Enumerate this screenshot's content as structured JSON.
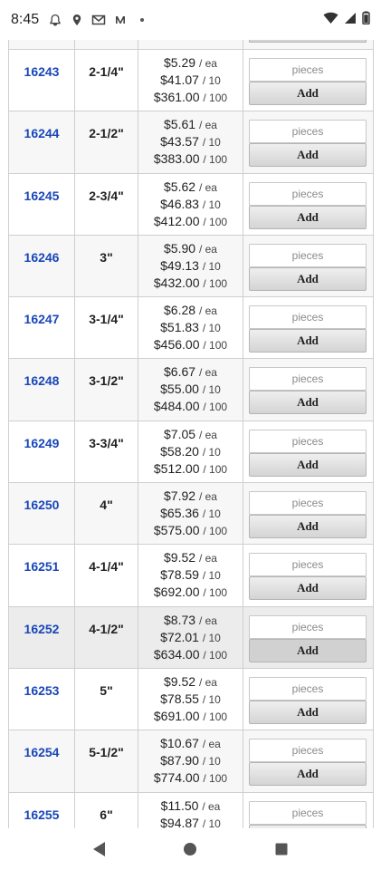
{
  "status_bar": {
    "time": "8:45",
    "left_icons": [
      "notification-bell-icon",
      "location-pin-icon",
      "gmail-icon",
      "medium-icon",
      "dot-icon"
    ],
    "right_icons": [
      "wifi-icon",
      "cell-signal-icon",
      "battery-icon"
    ]
  },
  "table": {
    "rows": [
      {
        "number": "16243",
        "size": "2-1/4\"",
        "prices": [
          {
            "amount": "$5.29",
            "unit": "/ ea"
          },
          {
            "amount": "$41.07",
            "unit": "/ 10"
          },
          {
            "amount": "$361.00",
            "unit": "/ 100"
          }
        ],
        "placeholder": "pieces",
        "button": "Add"
      },
      {
        "number": "16244",
        "size": "2-1/2\"",
        "prices": [
          {
            "amount": "$5.61",
            "unit": "/ ea"
          },
          {
            "amount": "$43.57",
            "unit": "/ 10"
          },
          {
            "amount": "$383.00",
            "unit": "/ 100"
          }
        ],
        "placeholder": "pieces",
        "button": "Add"
      },
      {
        "number": "16245",
        "size": "2-3/4\"",
        "prices": [
          {
            "amount": "$5.62",
            "unit": "/ ea"
          },
          {
            "amount": "$46.83",
            "unit": "/ 10"
          },
          {
            "amount": "$412.00",
            "unit": "/ 100"
          }
        ],
        "placeholder": "pieces",
        "button": "Add"
      },
      {
        "number": "16246",
        "size": "3\"",
        "prices": [
          {
            "amount": "$5.90",
            "unit": "/ ea"
          },
          {
            "amount": "$49.13",
            "unit": "/ 10"
          },
          {
            "amount": "$432.00",
            "unit": "/ 100"
          }
        ],
        "placeholder": "pieces",
        "button": "Add"
      },
      {
        "number": "16247",
        "size": "3-1/4\"",
        "prices": [
          {
            "amount": "$6.28",
            "unit": "/ ea"
          },
          {
            "amount": "$51.83",
            "unit": "/ 10"
          },
          {
            "amount": "$456.00",
            "unit": "/ 100"
          }
        ],
        "placeholder": "pieces",
        "button": "Add"
      },
      {
        "number": "16248",
        "size": "3-1/2\"",
        "prices": [
          {
            "amount": "$6.67",
            "unit": "/ ea"
          },
          {
            "amount": "$55.00",
            "unit": "/ 10"
          },
          {
            "amount": "$484.00",
            "unit": "/ 100"
          }
        ],
        "placeholder": "pieces",
        "button": "Add"
      },
      {
        "number": "16249",
        "size": "3-3/4\"",
        "prices": [
          {
            "amount": "$7.05",
            "unit": "/ ea"
          },
          {
            "amount": "$58.20",
            "unit": "/ 10"
          },
          {
            "amount": "$512.00",
            "unit": "/ 100"
          }
        ],
        "placeholder": "pieces",
        "button": "Add"
      },
      {
        "number": "16250",
        "size": "4\"",
        "prices": [
          {
            "amount": "$7.92",
            "unit": "/ ea"
          },
          {
            "amount": "$65.36",
            "unit": "/ 10"
          },
          {
            "amount": "$575.00",
            "unit": "/ 100"
          }
        ],
        "placeholder": "pieces",
        "button": "Add"
      },
      {
        "number": "16251",
        "size": "4-1/4\"",
        "prices": [
          {
            "amount": "$9.52",
            "unit": "/ ea"
          },
          {
            "amount": "$78.59",
            "unit": "/ 10"
          },
          {
            "amount": "$692.00",
            "unit": "/ 100"
          }
        ],
        "placeholder": "pieces",
        "button": "Add"
      },
      {
        "number": "16252",
        "size": "4-1/2\"",
        "prices": [
          {
            "amount": "$8.73",
            "unit": "/ ea"
          },
          {
            "amount": "$72.01",
            "unit": "/ 10"
          },
          {
            "amount": "$634.00",
            "unit": "/ 100"
          }
        ],
        "placeholder": "pieces",
        "button": "Add"
      },
      {
        "number": "16253",
        "size": "5\"",
        "prices": [
          {
            "amount": "$9.52",
            "unit": "/ ea"
          },
          {
            "amount": "$78.55",
            "unit": "/ 10"
          },
          {
            "amount": "$691.00",
            "unit": "/ 100"
          }
        ],
        "placeholder": "pieces",
        "button": "Add"
      },
      {
        "number": "16254",
        "size": "5-1/2\"",
        "prices": [
          {
            "amount": "$10.67",
            "unit": "/ ea"
          },
          {
            "amount": "$87.90",
            "unit": "/ 10"
          },
          {
            "amount": "$774.00",
            "unit": "/ 100"
          }
        ],
        "placeholder": "pieces",
        "button": "Add"
      },
      {
        "number": "16255",
        "size": "6\"",
        "prices": [
          {
            "amount": "$11.50",
            "unit": "/ ea"
          },
          {
            "amount": "$94.87",
            "unit": "/ 10"
          },
          {
            "amount": "",
            "unit": ""
          }
        ],
        "placeholder": "pieces",
        "button": ""
      }
    ]
  },
  "nav_bar": {
    "icons": [
      "back-triangle-icon",
      "home-circle-icon",
      "recents-square-icon"
    ]
  },
  "colors": {
    "link": "#1a47b8",
    "border": "#cfcfcf",
    "row_highlight": "#ececec"
  }
}
